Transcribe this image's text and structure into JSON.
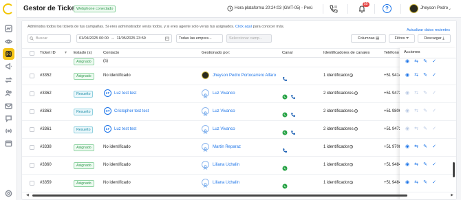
{
  "header": {
    "title": "Gestor de Tickets",
    "status_badge": "Webphone conectado",
    "platform_time": "Hora plataforma 20:24:03 (GMT-05) - Perú",
    "notifications_count": "55",
    "help_label": "?",
    "user_name": "Jheyson Pedro",
    "caret": "⌄"
  },
  "sidebar": {
    "icons": [
      "logo-icon",
      "activity-icon",
      "eye-icon",
      "tickets-icon",
      "megaphone-icon",
      "transfer-icon",
      "users-icon",
      "mail-icon",
      "chat-icon",
      "broadcast-icon",
      "calendar-icon",
      "settings-icon"
    ]
  },
  "main": {
    "description": "Administra todos los tickets de tus campañas. Si eres administrador verás todos, y si eres agente solo verás tus asignados.",
    "description_link": "Click aquí",
    "description_suffix": "para conocer más.",
    "update_link": "Actualizar datos recientes"
  },
  "filters": {
    "search_placeholder": "Buscar",
    "date_range_start": "01/04/2025 00:00",
    "date_range_arrow": "→",
    "date_range_end": "11/05/2025 23:59",
    "companies_select": "Todas las empres...",
    "campaign_select_placeholder": "Seleccionar camp...",
    "columns_button": "Columnas",
    "filters_button": "Filtros",
    "download_button": "Descargar"
  },
  "table": {
    "headers": {
      "ticket_id": "Ticket ID",
      "status": "Estado (s)",
      "contact": "Contacto",
      "managed_by": "Gestionado por:",
      "channel": "Canal",
      "identifiers": "Identificadores de canales",
      "phone": "Teléfono",
      "actions": "Acciones"
    },
    "partial_row": {
      "status": "Asignado",
      "contact": "(s)"
    },
    "rows": [
      {
        "id": "#3352",
        "status": "Asignado",
        "contact": "No identificado",
        "manager": "Jheyson Pedro Portocarrero Alfaro",
        "identifiers": "1 identificador",
        "phone": "+51 9414"
      },
      {
        "id": "#3362",
        "status": "Resuelto",
        "contact_initials": "LT",
        "contact": "Luz test test",
        "manager": "Luz Vivanco",
        "identifiers": "2 identificadores",
        "phone": "+51 9472"
      },
      {
        "id": "#3363",
        "status": "Resuelto",
        "contact_initials": "CT",
        "contact": "Cristopher test test",
        "manager": "Luz Vivanco",
        "identifiers": "2 identificadores",
        "phone": "+51 9806"
      },
      {
        "id": "#3361",
        "status": "Resuelto",
        "contact_initials": "LT",
        "contact": "Luz test test",
        "manager": "Luz Vivanco",
        "identifiers": "2 identificadores",
        "phone": "+51 9472"
      },
      {
        "id": "#3338",
        "status": "Asignado",
        "contact": "No identificado",
        "manager": "Martin Reparaz",
        "identifiers": "1 identificador",
        "phone": "+51 9708"
      },
      {
        "id": "#3360",
        "status": "Asignado",
        "contact": "No identificado",
        "manager": "Liliana Uchalin",
        "identifiers": "1 identificador",
        "phone": "+51 9484"
      },
      {
        "id": "#3359",
        "status": "Asignado",
        "contact": "No identificado",
        "manager": "Liliana Uchalin",
        "identifiers": "1 identificador",
        "phone": "+51 9484"
      }
    ]
  },
  "colors": {
    "accent": "#f5c518",
    "link": "#1a73e8",
    "assigned": "#2f9a4e",
    "resolved": "#1f8fa8",
    "whatsapp": "#25a244",
    "phone": "#1a5fb4",
    "badge_red": "#e54b4b"
  }
}
